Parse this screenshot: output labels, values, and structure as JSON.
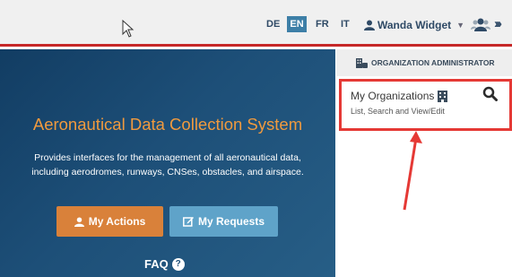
{
  "topbar": {
    "languages": {
      "de": "DE",
      "en": "EN",
      "fr": "FR",
      "it": "IT"
    },
    "selected_language": "EN",
    "user_name": "Wanda Widget"
  },
  "hero": {
    "title": "Aeronautical Data Collection System",
    "description": "Provides interfaces for the management of all aeronautical data, including aerodromes, runways, CNSes, obstacles, and airspace.",
    "my_actions_label": "My Actions",
    "my_requests_label": "My Requests",
    "faq_label": "FAQ"
  },
  "sidebar": {
    "header": "ORGANIZATION ADMINISTRATOR",
    "card": {
      "title": "My Organizations",
      "subtitle": "List, Search and View/Edit"
    }
  },
  "colors": {
    "accent_red": "#e53935",
    "hero_blue": "#1d4f78",
    "orange": "#d9813a",
    "light_blue": "#5fa3c9",
    "active_lang": "#3d7fa7"
  },
  "icons": [
    "mouse-cursor-icon",
    "user-icon",
    "caret-down-icon",
    "users-roles-icon",
    "double-chevron-right-icon",
    "edit-icon",
    "question-circle-icon",
    "organization-admin-icon",
    "building-icon",
    "search-icon"
  ]
}
